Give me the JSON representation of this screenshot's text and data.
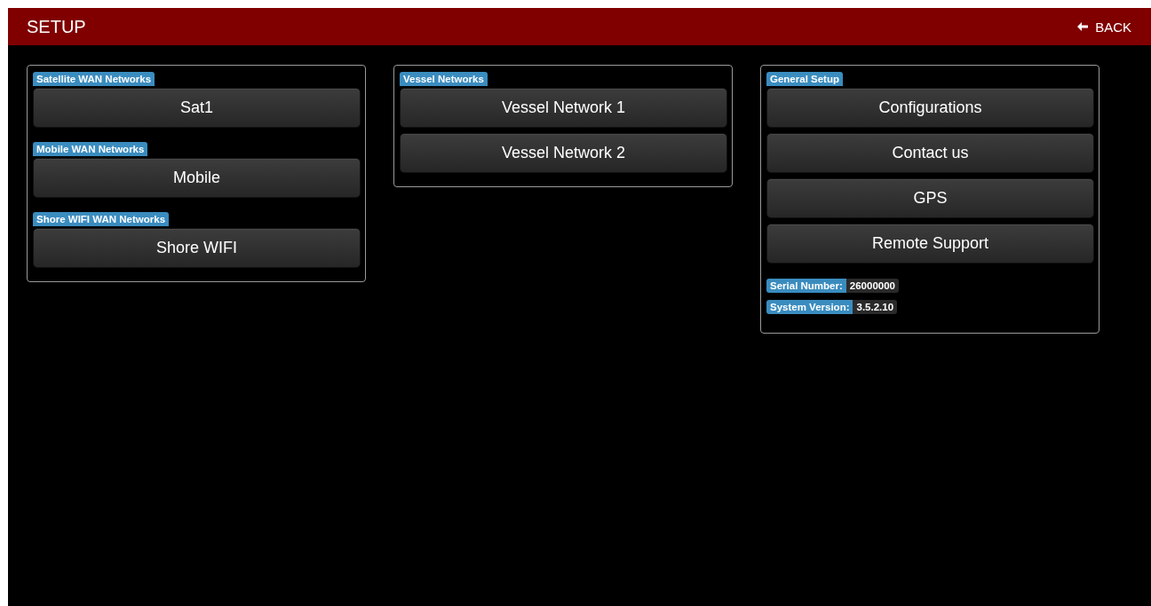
{
  "header": {
    "title": "SETUP",
    "back": "BACK"
  },
  "panels": [
    {
      "sections": [
        {
          "title": "Satellite WAN Networks",
          "buttons": [
            "Sat1"
          ]
        },
        {
          "title": "Mobile WAN Networks",
          "buttons": [
            "Mobile"
          ]
        },
        {
          "title": "Shore WIFI WAN Networks",
          "buttons": [
            "Shore WIFI"
          ]
        }
      ]
    },
    {
      "sections": [
        {
          "title": "Vessel Networks",
          "buttons": [
            "Vessel Network 1",
            "Vessel Network 2"
          ]
        }
      ]
    },
    {
      "sections": [
        {
          "title": "General Setup",
          "buttons": [
            "Configurations",
            "Contact us",
            "GPS",
            "Remote Support"
          ]
        }
      ],
      "info": [
        {
          "label": "Serial Number:",
          "value": "26000000"
        },
        {
          "label": "System Version:",
          "value": "3.5.2.10"
        }
      ]
    }
  ]
}
